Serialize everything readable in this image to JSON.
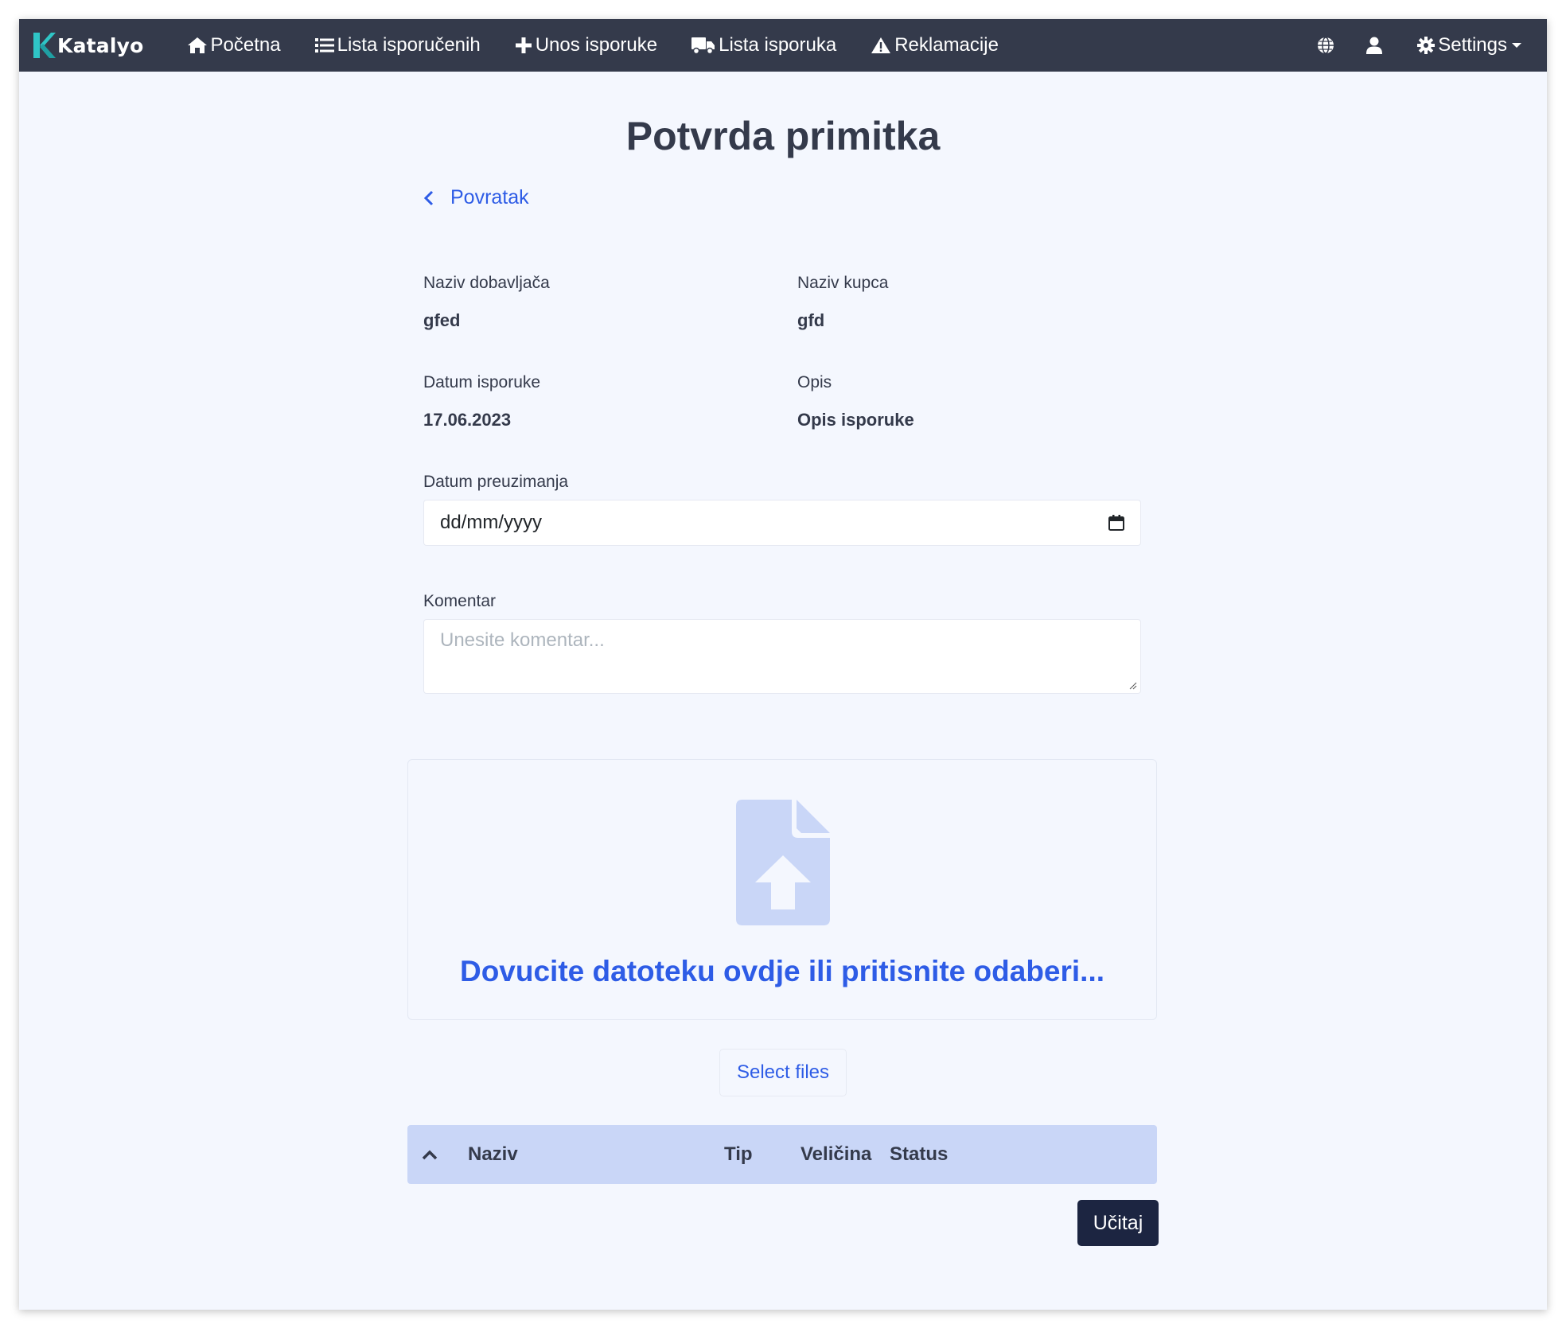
{
  "navbar": {
    "brand": "Katalyo",
    "items": [
      {
        "label": "Početna",
        "icon": "home-icon"
      },
      {
        "label": "Lista isporučenih",
        "icon": "list-icon"
      },
      {
        "label": "Unos isporuke",
        "icon": "plus-icon"
      },
      {
        "label": "Lista isporuka",
        "icon": "truck-icon"
      },
      {
        "label": "Reklamacije",
        "icon": "warning-icon"
      }
    ],
    "settings_label": "Settings"
  },
  "page": {
    "title": "Potvrda primitka",
    "back_label": "Povratak"
  },
  "details": {
    "supplier_label": "Naziv dobavljača",
    "supplier_value": "gfed",
    "customer_label": "Naziv kupca",
    "customer_value": "gfd",
    "delivery_date_label": "Datum isporuke",
    "delivery_date_value": "17.06.2023",
    "description_label": "Opis",
    "description_value": "Opis isporuke"
  },
  "form": {
    "pickup_date_label": "Datum preuzimanja",
    "pickup_date_placeholder": "dd/mm/yyyy",
    "comment_label": "Komentar",
    "comment_placeholder": "Unesite komentar..."
  },
  "upload": {
    "dropzone_text": "Dovucite datoteku ovdje ili pritisnite odaberi...",
    "select_files_label": "Select files",
    "table_headers": [
      "Naziv",
      "Tip",
      "Veličina",
      "Status"
    ],
    "submit_label": "Učitaj"
  },
  "colors": {
    "navbar": "#343a4b",
    "accent": "#2e5ce6",
    "brand_mark": "#2fc5c6",
    "table_header": "#c9d6f7",
    "primary_button": "#1c2541"
  }
}
